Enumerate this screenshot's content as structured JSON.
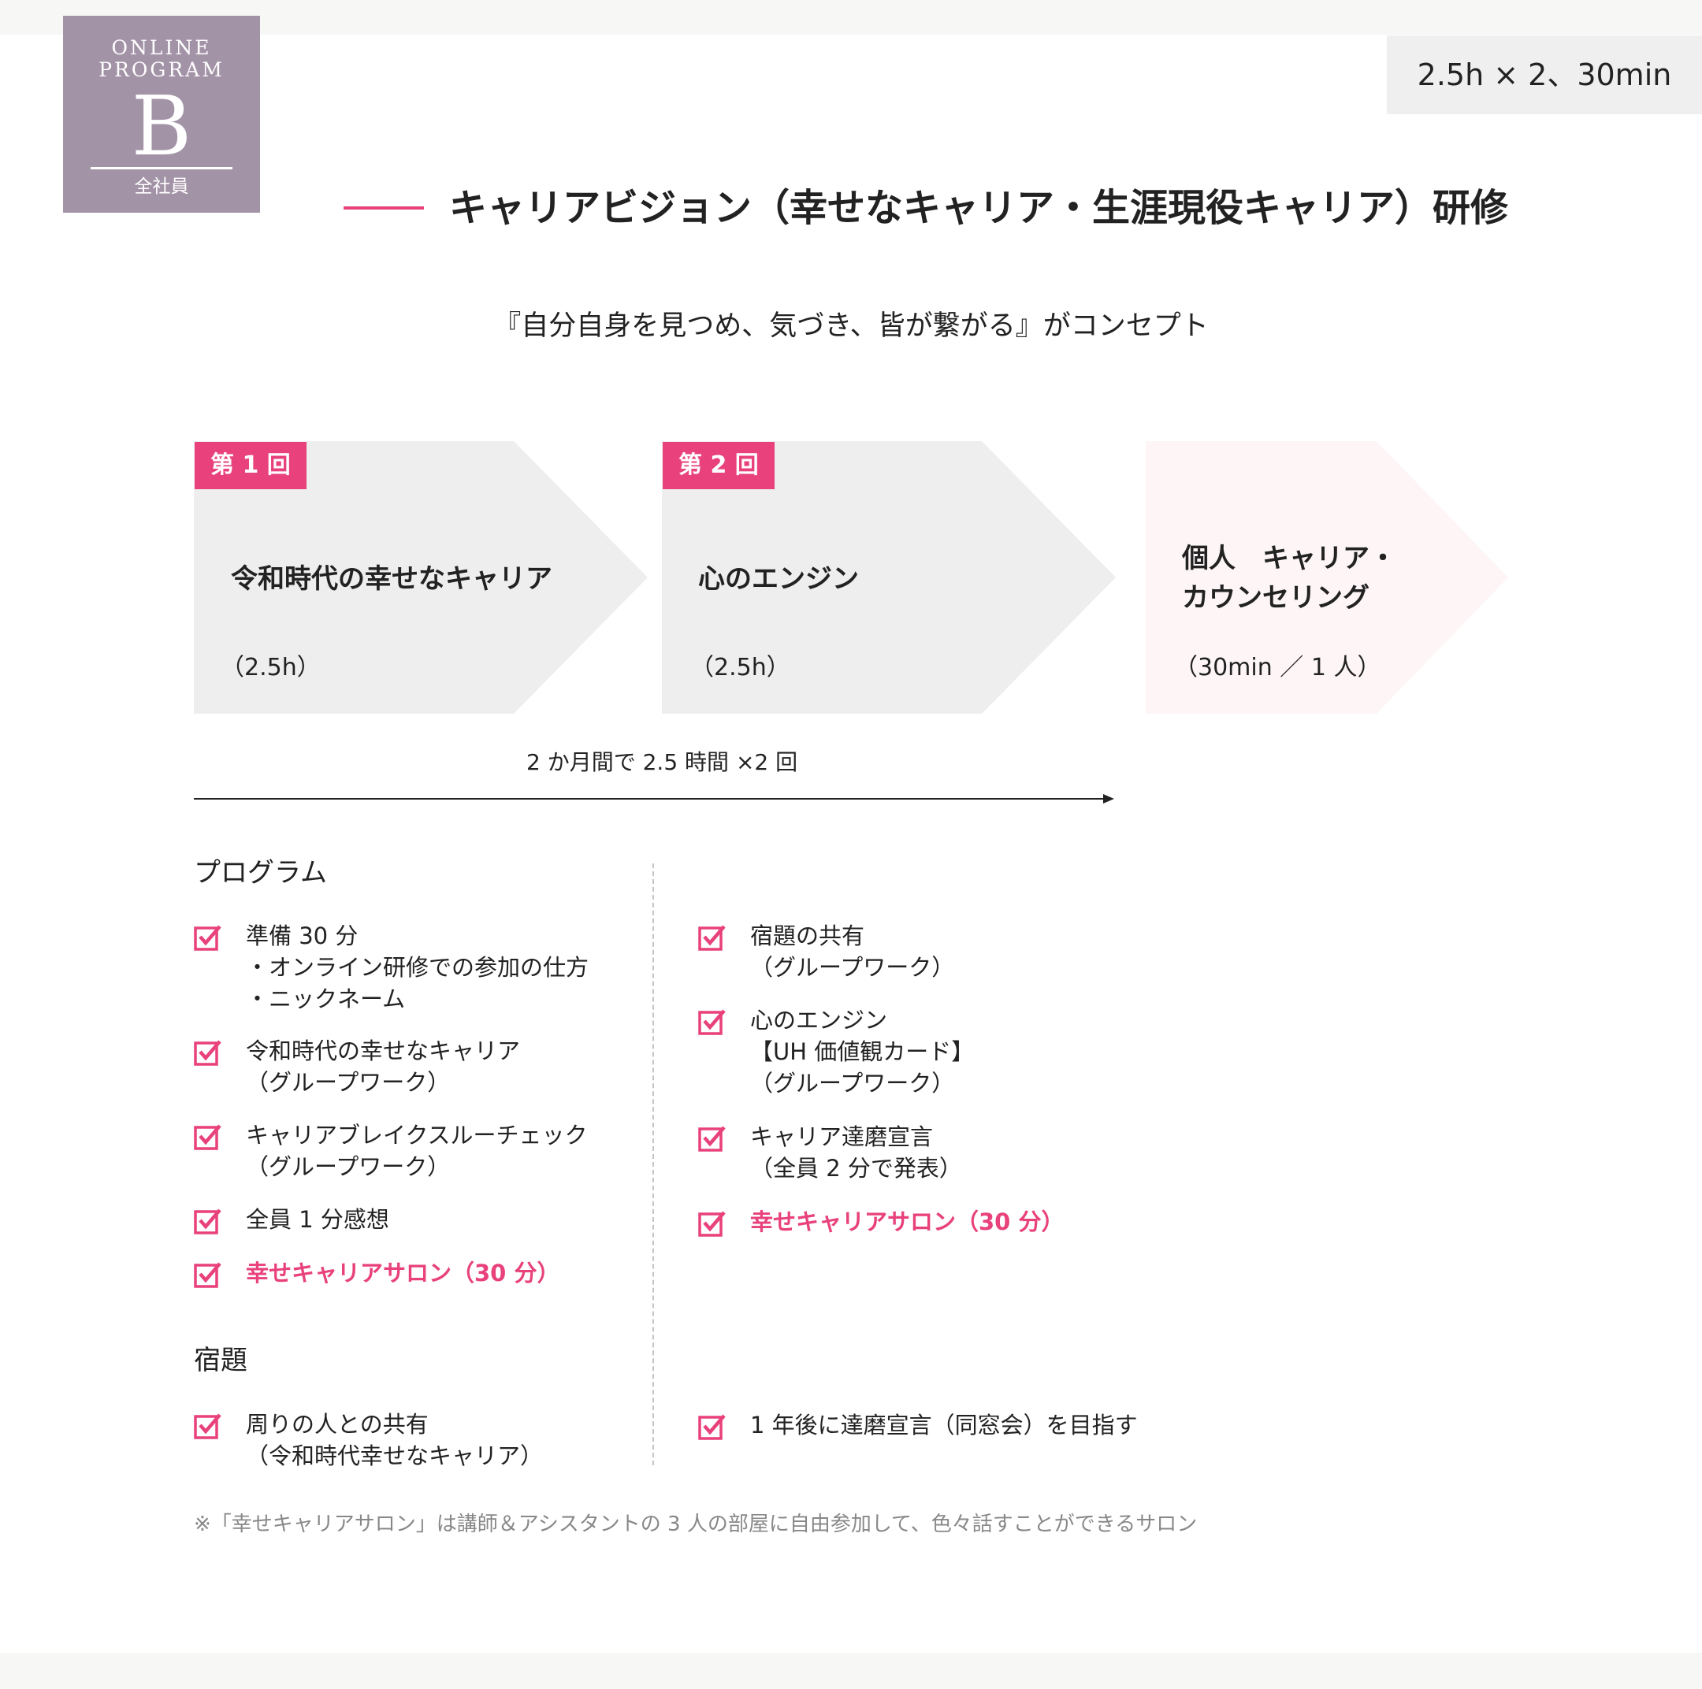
{
  "badge": {
    "line1": "ONLINE",
    "line2": "PROGRAM",
    "letter": "B",
    "target": "全社員"
  },
  "duration": "2.5h × 2、30min",
  "title": "キャリアビジョン（幸せなキャリア・生涯現役キャリア）研修",
  "concept": "『自分自身を見つめ、気づき、皆が繋がる』がコンセプト",
  "steps": [
    {
      "tag": "第 1 回",
      "name": [
        "令和時代の幸せなキャリア"
      ],
      "duration": "（2.5h）"
    },
    {
      "tag": "第 2 回",
      "name": [
        "心のエンジン"
      ],
      "duration": "（2.5h）"
    },
    {
      "tag": "",
      "name": [
        "個人　キャリア・",
        "カウンセリング"
      ],
      "duration": "（30min ／ 1 人）"
    }
  ],
  "timeline_label": "2 か月間で 2.5 時間 ×2 回",
  "program": {
    "heading": "プログラム",
    "left": [
      {
        "lines": [
          "準備 30 分",
          "・オンライン研修での参加の仕方",
          "・ニックネーム"
        ]
      },
      {
        "lines": [
          "令和時代の幸せなキャリア",
          "（グループワーク）"
        ]
      },
      {
        "lines": [
          "キャリアブレイクスルーチェック",
          "（グループワーク）"
        ]
      },
      {
        "lines": [
          "全員 1 分感想"
        ]
      },
      {
        "lines": [
          "幸せキャリアサロン（30 分）"
        ],
        "highlight": true
      }
    ],
    "right": [
      {
        "lines": [
          "宿題の共有",
          "（グループワーク）"
        ]
      },
      {
        "lines": [
          "心のエンジン",
          "【UH 価値観カード】",
          "（グループワーク）"
        ]
      },
      {
        "lines": [
          "キャリア達磨宣言",
          "（全員 2 分で発表）"
        ]
      },
      {
        "lines": [
          "幸せキャリアサロン（30 分）"
        ],
        "highlight": true
      }
    ]
  },
  "homework": {
    "heading": "宿題",
    "left": [
      {
        "lines": [
          "周りの人との共有",
          "（令和時代幸せなキャリア）"
        ]
      }
    ],
    "right": [
      {
        "lines": [
          "1 年後に達磨宣言（同窓会）を目指す"
        ]
      }
    ]
  },
  "footnote": "※「幸せキャリアサロン」は講師＆アシスタントの 3 人の部屋に自由参加して、色々話すことができるサロン",
  "colors": {
    "accent": "#e8417b",
    "badge": "#a393a7",
    "chevron_gray": "#eeeeee",
    "chevron_pink": "#fdf5f6"
  },
  "icons": {
    "check": "checkbox-check-icon"
  }
}
